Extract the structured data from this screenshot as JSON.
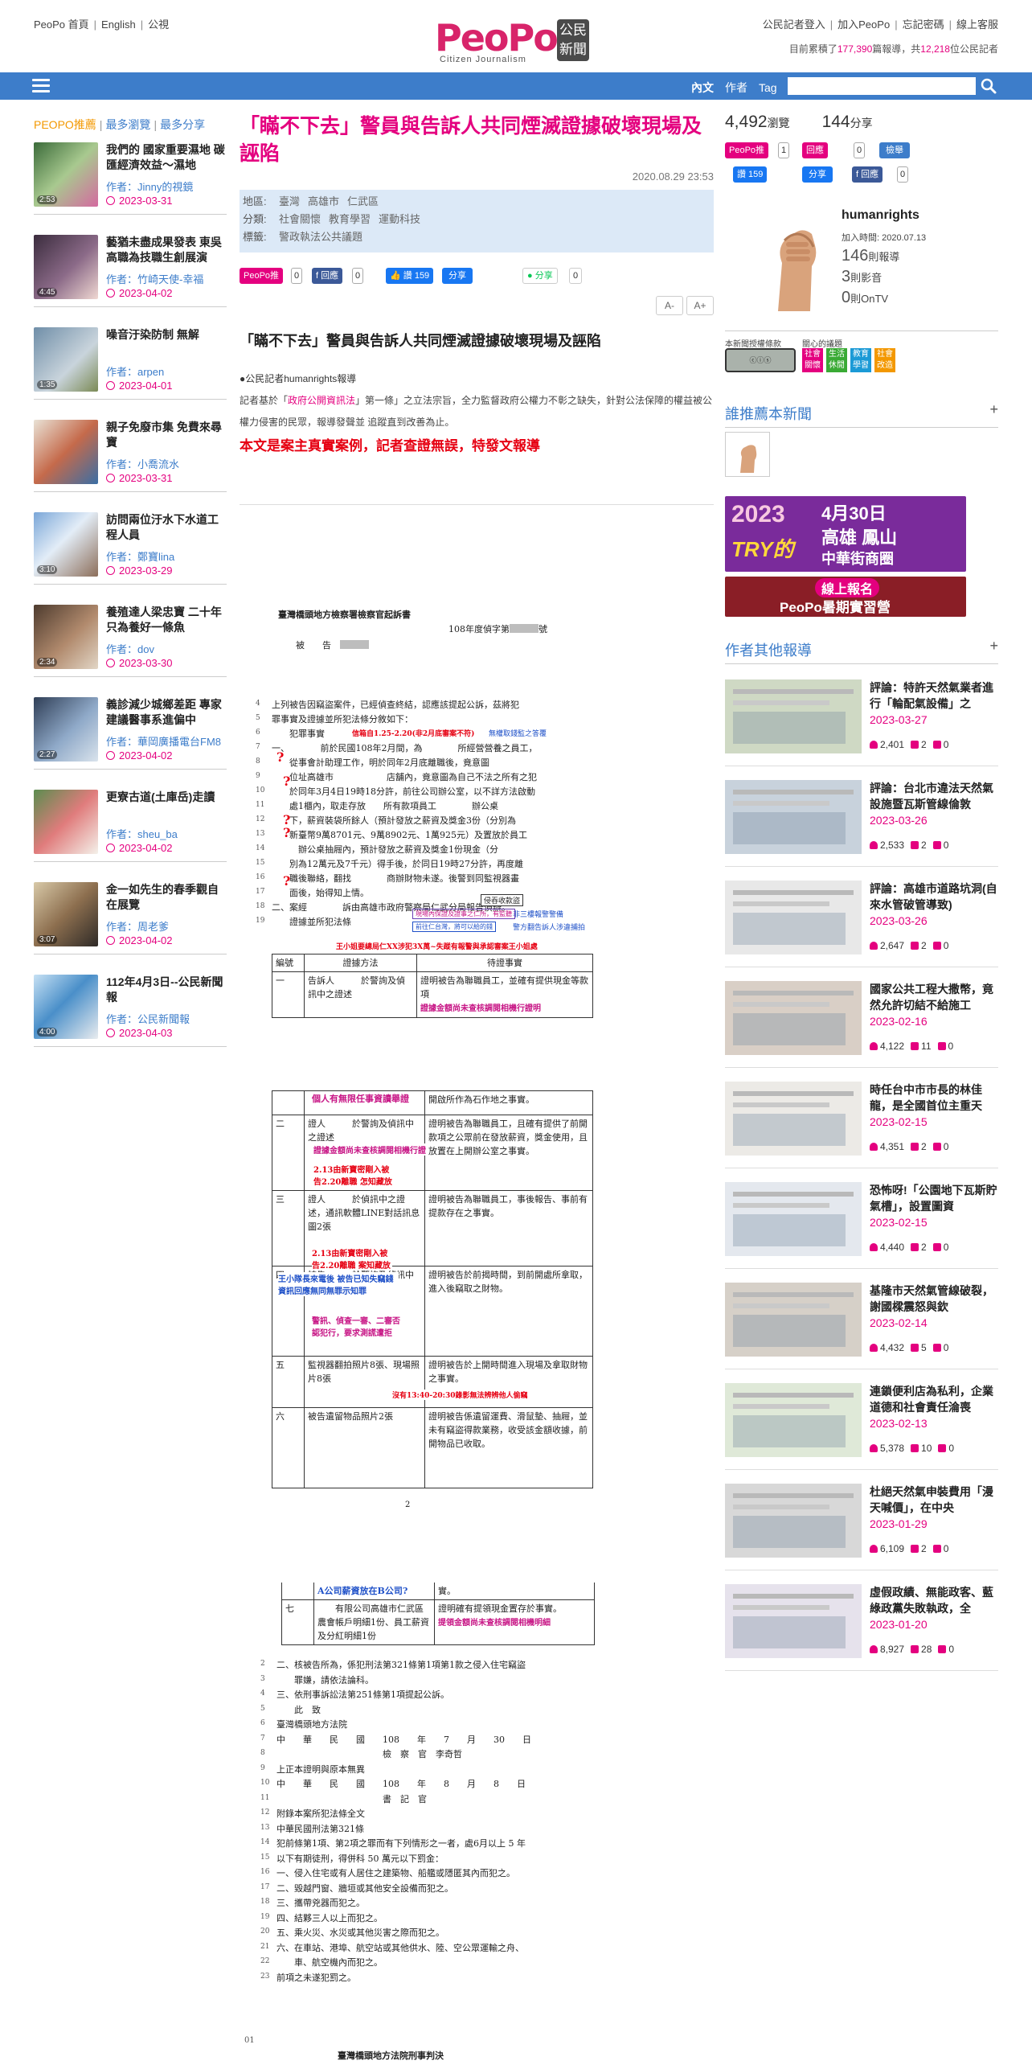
{
  "top": {
    "links": [
      "PeoPo 首頁",
      "English",
      "公視"
    ],
    "logo_text": "PeoPo",
    "logo_tag": "公民新聞",
    "logo_sub": "Citizen Journalism",
    "right_links": [
      "公民記者登入",
      "加入PeoPo",
      "忘記密碼",
      "線上客服"
    ],
    "stat_prefix": "目前累積了",
    "stat_articles": "177,390",
    "stat_mid": "篇報導，共",
    "stat_users": "12,218",
    "stat_suffix": "位公民記者"
  },
  "nav": {
    "tabs": [
      "內文",
      "作者",
      "Tag"
    ],
    "search_placeholder": ""
  },
  "left": {
    "tabs": [
      "PEOPO推薦",
      "最多瀏覽",
      "最多分享"
    ],
    "items": [
      {
        "title": "我們的 國家重要濕地 碳匯經濟效益～濕地",
        "author": "作者：Jinny的視鏡",
        "date": "2023-03-31",
        "dur": "2:53"
      },
      {
        "title": "藝猶未盡成果發表 東吳高職為技職生創展演",
        "author": "作者：竹崎天使-幸福",
        "date": "2023-04-02",
        "dur": "4:45"
      },
      {
        "title": "噪音汙染防制 無解",
        "author": "作者：arpen",
        "date": "2023-04-01",
        "dur": "1:35"
      },
      {
        "title": "親子免廢市集 免費來尋寶",
        "author": "作者：小喬流水",
        "date": "2023-03-31",
        "dur": ""
      },
      {
        "title": "訪問兩位汙水下水道工程人員",
        "author": "作者：鄭寶lina",
        "date": "2023-03-29",
        "dur": "3:10"
      },
      {
        "title": "養殖達人梁忠寶 二十年只為養好一條魚",
        "author": "作者：dov",
        "date": "2023-03-30",
        "dur": "2:34"
      },
      {
        "title": "義診減少城鄉差距 專家建議醫事系進偏中",
        "author": "作者：華岡廣播電台FM8",
        "date": "2023-04-02",
        "dur": "2:27"
      },
      {
        "title": "更寮古道(土庫岳)走讀",
        "author": "作者：sheu_ba",
        "date": "2023-04-02",
        "dur": ""
      },
      {
        "title": "金一如先生的春季觀自在展覽",
        "author": "作者：周老爹",
        "date": "2023-04-02",
        "dur": "3:07"
      },
      {
        "title": "112年4月3日--公民新聞報",
        "author": "作者：公民新聞報",
        "date": "2023-04-03",
        "dur": "4:00"
      }
    ]
  },
  "article": {
    "title": "「瞞不下去」警員與告訴人共同煙滅證據破壞現場及誣陷",
    "date": "2020.08.29 23:53",
    "meta": {
      "region_label": "地區:",
      "region": [
        "臺灣",
        "高雄市",
        "仁武區"
      ],
      "cat_label": "分類:",
      "cat": [
        "社會關懷",
        "教育學習",
        "運動科技"
      ],
      "tag_label": "標籤:",
      "tag": [
        "警政執法公共議題"
      ]
    },
    "share": {
      "peopo": "PeoPo推",
      "peopo_count": "0",
      "fb": "回應",
      "fb_count": "0",
      "like": "讚 159",
      "share": "分享",
      "line": "分享",
      "line_count": "0"
    },
    "font_buttons": [
      "A-",
      "A+"
    ],
    "h2": "「瞞不下去」警員與告訴人共同煙滅證據破壞現場及誣陷",
    "byline": "●公民記者humanrights報導",
    "intro_a": "記者基於「",
    "intro_link": "政府公開資訊法",
    "intro_b": "」第一條」之立法宗旨，全力監督政府公權力不彰之缺失，針對公法保障的權益被公權力侵害的民眾，報導發聲並 追蹤直到改善為止。",
    "notice": "本文是案主真實案例，記者查證無誤，特發文報導"
  },
  "doc": {
    "p1_title": "臺灣橋頭地方檢察署檢察官起訴書",
    "p1_case": "108年度偵字第",
    "p1_case_end": "號",
    "p1_def": "被　　告",
    "p1_lines": [
      "上列被告因竊盜案件，已經偵查終結，認應該提起公訴，茲將犯",
      "罪事實及證據並所犯法條分敘如下：",
      "　　犯罪事實",
      "一、　　　　前於民國108年2月間，為　　　　所經營營養之員工，",
      "　　從事會計助理工作，明於同年2月底離職後，竟意圖",
      "　　位址高雄市　　　　　　店舖內，竟意圖為自己不法之所有之犯",
      "　　於同年3月4日19時18分許，前往公司辦公室，以不詳方法啟動",
      "　　處1櫃內，取走存放　　所有款項員工　　　　辦公桌",
      "　　下，薪資裝袋所餘人（預計發放之薪資及獎金3份（分別為",
      "　　新臺幣9萬8701元、9萬8902元、1萬925元）及置放於員工",
      "　　　辦公桌抽屜內，預計發放之薪資及獎金1份現金（分",
      "　　別為12萬元及7千元）得手後，於同日19時27分許，再度離",
      "　　職後聯絡，翻找　　　　商辦財物未遂。後警到同監視器畫",
      "　　面後，始得知上情。",
      "二、案經　　　　訴由高雄市政府警察局仁武分局報告偵辦。",
      "　　證據並所犯法條"
    ],
    "p1_ann1": "信箱自1.25-2.20(非2月底審案不符)",
    "p1_ann2": "無權取錢監之答覆",
    "p1_ann3": "非三樓報警警備",
    "p1_ann4": "警方翻告訴人涉違捕拍",
    "p1_ann5": "王小姐要總局仁XX涉犯3X萬~失蹤有報警與承認審案王小姐處",
    "p1_ann6": "侵吞收款盜",
    "p1_ann7": "現場內保證及證事之仁所，有監聽",
    "p1_ann8": "前往仁台灣，將可以給的錢",
    "p1_table_head": [
      "編號",
      "證據方法",
      "待證事實"
    ],
    "p1_table_r1": [
      "一",
      "告訴人　　　於警詢及偵訊中之證述",
      "證明被告為聯職員工，並確有提供現金等款項"
    ],
    "p1_ann9": "證據金額尚未查核調閱相機行證明",
    "p2_rows": [
      {
        "n": "",
        "a": "",
        "b": "開啟所作為石作地之事實。"
      },
      {
        "n": "二",
        "a": "證人　　　於警詢及偵訊中之證述",
        "b": "證明被告為聯職員工，且確有提供了前開款項之公眾前在發放薪資，獎金使用，且放置在上開辦公室之事實。"
      },
      {
        "n": "三",
        "a": "證人　　　於偵訊中之證述，通訊軟體LINE對話訊息圖2張",
        "b": "證明被告為聯職員工，事後報告、事前有提款存在之事實。"
      },
      {
        "n": "四",
        "a": "被告　　　於警詢及偵訊中之供述",
        "b": "證明被告於前揭時間，到前開處所拿取，進入後竊取之財物。"
      },
      {
        "n": "五",
        "a": "監視器翻拍照片8張、現場照片8張",
        "b": "證明被告於上開時間進入現場及拿取財物之事實。"
      },
      {
        "n": "六",
        "a": "被告遺留物品照片2張",
        "b": "證明被告係遺留運費、滑鼠墊、抽屜，並未有竊盜得款業務，收受該金額收據，前開物品已收取。"
      }
    ],
    "p2_ann1": "個人有無限任事資讀舉證",
    "p2_ann2": "證據金額尚未查核調閱相機行證",
    "p2_ann3": "2.13由新寶密剛入被告2.20離職 怎知藏放",
    "p2_ann4": "2.13由新寶密剛入被告2.20離職 案知藏放",
    "p2_ann5": "王小隊長來電後 被告已知失竊錢 資訊回應無同無罪示知罪",
    "p2_ann6": "警訊、偵查一審、二審否認犯行，要求測謊遭拒",
    "p2_ann7": "沒有13:40-20:30錄影無法辨辨他人偷竊",
    "page_num": "2",
    "p3_row_ann": "A公司薪資放在B公司?",
    "p3_row": {
      "n": "七",
      "a": "　　有限公司高雄市仁武區農會帳戶明細1份、員工薪資及分紅明細1份",
      "b": "證明確有提領現金置存於事實。"
    },
    "p3_row_ann2": "提領金額尚未查核調閱相機明細",
    "p3_lines": [
      "二、核被告所為，係犯刑法第321條第1項第1款之侵入住宅竊盜",
      "　　罪嫌，請依法論科。",
      "三、依刑事訴訟法第251條第1項提起公訴。",
      "　　此　致",
      "臺灣橋頭地方法院",
      "中　　華　　民　　國　　108　　年　　7　　月　　30　　日",
      "　　　　　　　　　　　　檢　察　官　李奇哲",
      "上正本證明與原本無異",
      "中　　華　　民　　國　　108　　年　　8　　月　　8　　日",
      "　　　　　　　　　　　　書　記　官",
      "附錄本案所犯法條全文",
      "中華民國刑法第321條",
      "犯前條第1項、第2項之罪而有下列情形之一者，處6月以上 5 年",
      "以下有期徒刑，得併科 50 萬元以下罰金：",
      "一、侵入住宅或有人居住之建築物、船艦或隱匿其內而犯之。",
      "二、毀越門窗、牆垣或其他安全設備而犯之。",
      "三、攜帶兇器而犯之。",
      "四、結夥三人以上而犯之。",
      "五、乘火災、水災或其他災害之際而犯之。",
      "六、在車站、港埠、航空站或其他供水、陸、空公眾運輸之舟、",
      "　　車、航空機內而犯之。",
      "前項之未遂犯罰之。"
    ],
    "p4_num": "01",
    "p4_title": "臺灣橋頭地方法院刑事判決"
  },
  "right": {
    "views": "4,492",
    "views_label": "瀏覽",
    "shares": "144",
    "shares_label": "分享",
    "btn_push": "PeoPo推",
    "btn_push_count": "1",
    "btn_reply": "回應",
    "btn_reply_count": "0",
    "btn_report": "檢舉",
    "like": "讚 159",
    "share": "分享",
    "reply2": "回應",
    "reply2_count": "0",
    "profile": {
      "name": "humanrights",
      "joined": "加入時間: 2020.07.13",
      "reports": "146",
      "reports_label": "則報導",
      "videos": "3",
      "videos_label": "則影音",
      "ontv": "0",
      "ontv_label": "則OnTV"
    },
    "license_label": "本新聞授權條款",
    "topics_label": "關心的議題",
    "topics": [
      "社會關懷",
      "生活休閒",
      "教育學習",
      "社會改造"
    ],
    "recommend_title": "誰推薦本新聞",
    "banner1_year": "2023",
    "banner1_line1": "4月30日",
    "banner1_line2": "高雄 鳳山",
    "banner1_line3": "中華街商圈",
    "banner1_brand": "TRY的",
    "banner2_line1": "線上報名",
    "banner2_line2": "PeoPo暑期實習營",
    "other_title": "作者其他報導",
    "others": [
      {
        "title": "評論：特許天然氣業者進行「輪配氣設備」之",
        "date": "2023-03-27",
        "views": "2,401",
        "users": "2",
        "comments": "0"
      },
      {
        "title": "評論：台北市違法天然氣設施暨瓦斯管線倫敦",
        "date": "2023-03-26",
        "views": "2,533",
        "users": "2",
        "comments": "0"
      },
      {
        "title": "評論：高雄市道路坑洞(自來水管破管導致)",
        "date": "2023-03-26",
        "views": "2,647",
        "users": "2",
        "comments": "0"
      },
      {
        "title": "國家公共工程大撒幣，竟然允許切結不給施工",
        "date": "2023-02-16",
        "views": "4,122",
        "users": "11",
        "comments": "0"
      },
      {
        "title": "時任台中市市長的林佳龍，是全國首位主重天",
        "date": "2023-02-15",
        "views": "4,351",
        "users": "2",
        "comments": "0"
      },
      {
        "title": "恐怖呀!「公園地下瓦斯貯氣槽」，設置圖資",
        "date": "2023-02-15",
        "views": "4,440",
        "users": "2",
        "comments": "0"
      },
      {
        "title": "基隆市天然氣管線破裂，謝國樑震怒與欽",
        "date": "2023-02-14",
        "views": "4,432",
        "users": "5",
        "comments": "0"
      },
      {
        "title": "連鎖便利店為私利，企業道德和社會責任淪喪",
        "date": "2023-02-13",
        "views": "5,378",
        "users": "10",
        "comments": "0"
      },
      {
        "title": "杜絕天然氣申裝費用「漫天喊價」，在中央",
        "date": "2023-01-29",
        "views": "6,109",
        "users": "2",
        "comments": "0"
      },
      {
        "title": "虛假政績、無能政客、藍綠政黨失敗執政，全",
        "date": "2023-01-20",
        "views": "8,927",
        "users": "28",
        "comments": "0"
      }
    ]
  },
  "colors": {
    "brand": "#e4007f",
    "nav": "#3d7dca",
    "orange": "#f39800",
    "red": "#e60012"
  }
}
